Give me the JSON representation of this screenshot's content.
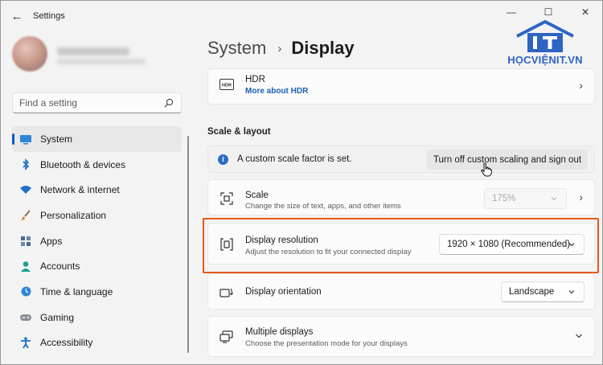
{
  "window": {
    "title": "Settings",
    "back_glyph": "←",
    "controls": [
      {
        "glyph": "—",
        "name": "minimize-button"
      },
      {
        "glyph": "☐",
        "name": "maximize-button"
      },
      {
        "glyph": "✕",
        "name": "close-button"
      }
    ]
  },
  "search": {
    "placeholder": "Find a setting"
  },
  "sidebar": {
    "items": [
      {
        "label": "System",
        "icon": "display-icon",
        "active": true
      },
      {
        "label": "Bluetooth & devices",
        "icon": "bluetooth-icon"
      },
      {
        "label": "Network & internet",
        "icon": "wifi-icon"
      },
      {
        "label": "Personalization",
        "icon": "brush-icon"
      },
      {
        "label": "Apps",
        "icon": "apps-icon"
      },
      {
        "label": "Accounts",
        "icon": "person-icon"
      },
      {
        "label": "Time & language",
        "icon": "globe-clock-icon"
      },
      {
        "label": "Gaming",
        "icon": "gamepad-icon"
      },
      {
        "label": "Accessibility",
        "icon": "accessibility-icon"
      }
    ]
  },
  "breadcrumb": {
    "parent": "System",
    "separator": "›",
    "current": "Display"
  },
  "logo": {
    "text": "HỌCVIỆNIT.VN"
  },
  "hdr": {
    "icon_text": "HDR",
    "title": "HDR",
    "link": "More about HDR"
  },
  "scale_layout": {
    "section_title": "Scale & layout",
    "info_text": "A custom scale factor is set.",
    "info_button": "Turn off custom scaling and sign out",
    "scale": {
      "title": "Scale",
      "subtitle": "Change the size of text, apps, and other items",
      "value": "175%"
    },
    "resolution": {
      "title": "Display resolution",
      "subtitle": "Adjust the resolution to fit your connected display",
      "value": "1920 × 1080 (Recommended)"
    },
    "orientation": {
      "title": "Display orientation",
      "value": "Landscape"
    },
    "multiple": {
      "title": "Multiple displays",
      "subtitle": "Choose the presentation mode for your displays"
    }
  },
  "colors": {
    "accent": "#005fb8",
    "highlight": "#e35a1a",
    "logo": "#2e64c2"
  }
}
